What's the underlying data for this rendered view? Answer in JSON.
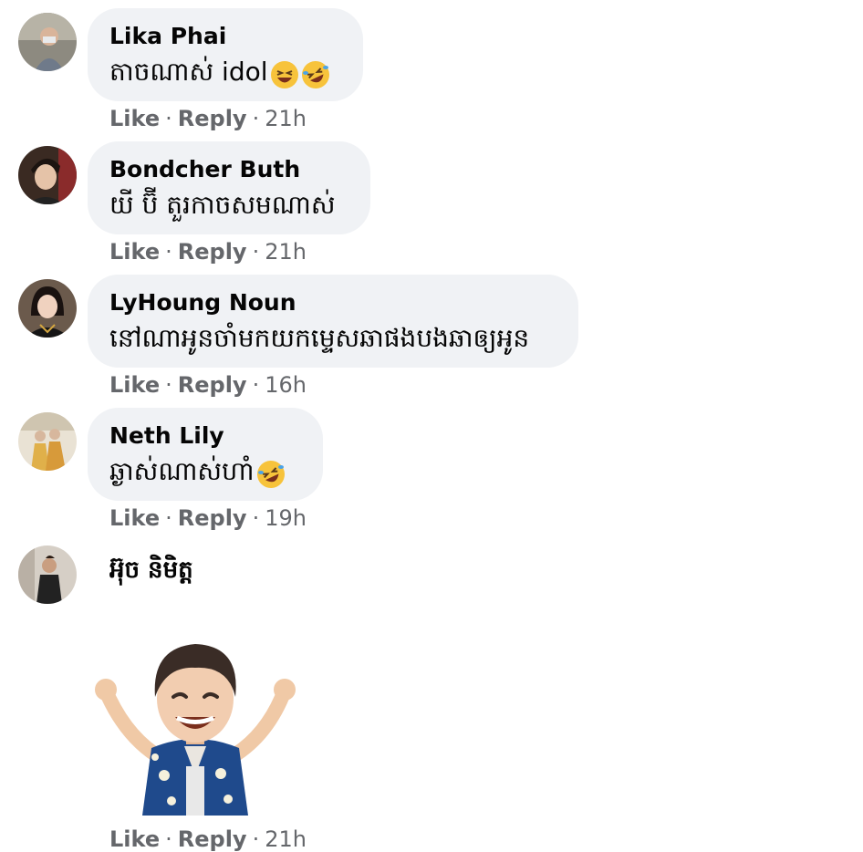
{
  "comments": [
    {
      "author": "Lika Phai",
      "text": "តាចណាស់ idol",
      "emojis": [
        "laughing-face",
        "rofl-face"
      ],
      "like": "Like",
      "reply": "Reply",
      "time": "21h"
    },
    {
      "author": "Bondcher Buth",
      "text": "យី ប៊ី តួរកាចសមណាស់",
      "emojis": [],
      "like": "Like",
      "reply": "Reply",
      "time": "21h"
    },
    {
      "author": "LyHoung Noun",
      "text": "នៅណាអូនចាំមកយកម្ទេសឆាផងបងឆាឲ្យអូន",
      "emojis": [],
      "like": "Like",
      "reply": "Reply",
      "time": "16h"
    },
    {
      "author": "Neth Lily",
      "text": "ឆ្ងាស់ណាស់ហាំ",
      "emojis": [
        "rofl-face"
      ],
      "like": "Like",
      "reply": "Reply",
      "time": "19h"
    },
    {
      "author": "អ៊ុច និមិត្ត",
      "sticker": "avatar-sticker-arms-raised",
      "like": "Like",
      "reply": "Reply",
      "time": "21h"
    }
  ],
  "separator": "·",
  "colors": {
    "bubble": "#f0f2f5",
    "meta": "#65676b",
    "text": "#050505"
  }
}
